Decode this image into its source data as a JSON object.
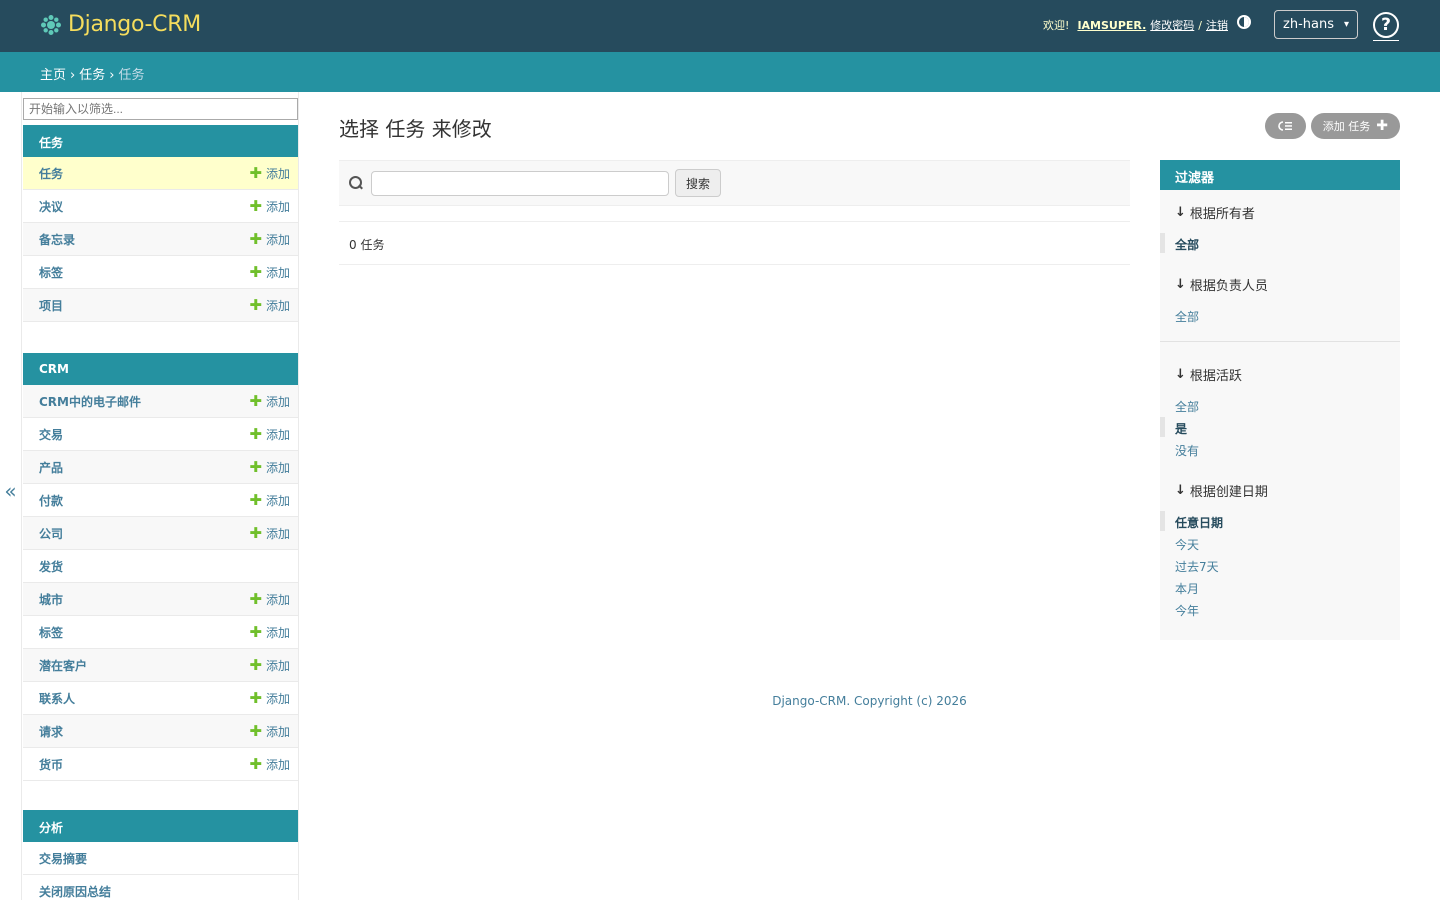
{
  "header": {
    "brand": "Django-CRM",
    "welcome": "欢迎!",
    "username": "IAMSUPER.",
    "change_password": "修改密码",
    "slash": "/",
    "logout": "注销",
    "language": "zh-hans",
    "help": "?"
  },
  "breadcrumbs": {
    "home": "主页",
    "app": "任务",
    "current": "任务",
    "sep": "›"
  },
  "sidebar": {
    "filter_placeholder": "开始输入以筛选...",
    "collapse": "«",
    "add_label": "添加",
    "modules": [
      {
        "caption": "任务",
        "rows": [
          {
            "label": "任务",
            "add": true
          },
          {
            "label": "决议",
            "add": true
          },
          {
            "label": "备忘录",
            "add": true
          },
          {
            "label": "标签",
            "add": true
          },
          {
            "label": "项目",
            "add": true
          }
        ]
      },
      {
        "caption": "CRM",
        "rows": [
          {
            "label": "CRM中的电子邮件",
            "add": true
          },
          {
            "label": "交易",
            "add": true
          },
          {
            "label": "产品",
            "add": true
          },
          {
            "label": "付款",
            "add": true
          },
          {
            "label": "公司",
            "add": true
          },
          {
            "label": "发货",
            "add": false
          },
          {
            "label": "城市",
            "add": true
          },
          {
            "label": "标签",
            "add": true
          },
          {
            "label": "潜在客户",
            "add": true
          },
          {
            "label": "联系人",
            "add": true
          },
          {
            "label": "请求",
            "add": true
          },
          {
            "label": "货币",
            "add": true
          }
        ]
      },
      {
        "caption": "分析",
        "rows": [
          {
            "label": "交易摘要",
            "add": false
          },
          {
            "label": "关闭原因总结",
            "add": false
          }
        ]
      }
    ]
  },
  "main": {
    "title": "选择 任务 来修改",
    "add_button": "添加 任务",
    "search_button": "搜索",
    "result_count": "0 任务"
  },
  "filter": {
    "title": "过滤器",
    "sections": [
      {
        "title": "根据所有者",
        "items": [
          {
            "label": "全部",
            "selected": true
          }
        ]
      },
      {
        "title": "根据负责人员",
        "items": [
          {
            "label": "全部",
            "selected": false
          }
        ]
      },
      {
        "title": "根据活跃",
        "items": [
          {
            "label": "全部",
            "selected": false
          },
          {
            "label": "是",
            "selected": true
          },
          {
            "label": "没有",
            "selected": false
          }
        ]
      },
      {
        "title": "根据创建日期",
        "items": [
          {
            "label": "任意日期",
            "selected": true
          },
          {
            "label": "今天",
            "selected": false
          },
          {
            "label": "过去7天",
            "selected": false
          },
          {
            "label": "本月",
            "selected": false
          },
          {
            "label": "今年",
            "selected": false
          }
        ]
      }
    ]
  },
  "footer": {
    "text": "Django-CRM. Copyright (c) 2026"
  },
  "colors": {
    "header": "#264b5d",
    "accent": "#2592a1",
    "brand": "#f5dd5d",
    "link": "#447e9b",
    "add_plus": "#70bf2b"
  }
}
